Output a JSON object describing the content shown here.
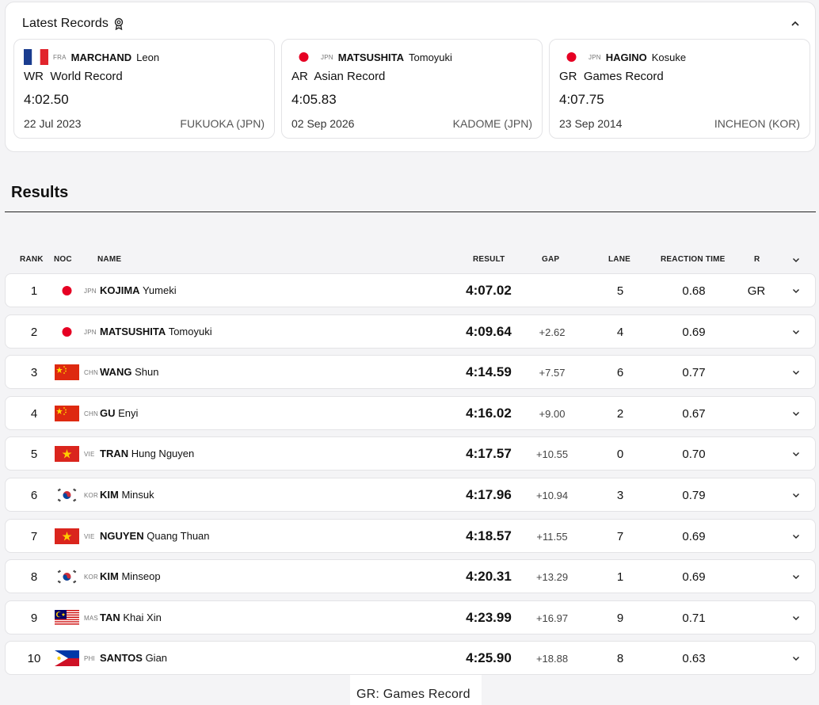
{
  "latest_records": {
    "title": "Latest Records",
    "cards": [
      {
        "noc": "FRA",
        "surname": "MARCHAND",
        "given": "Leon",
        "type_code": "WR",
        "type_name": "World Record",
        "time": "4:02.50",
        "date": "22 Jul 2023",
        "place": "FUKUOKA (JPN)"
      },
      {
        "noc": "JPN",
        "surname": "MATSUSHITA",
        "given": "Tomoyuki",
        "type_code": "AR",
        "type_name": "Asian Record",
        "time": "4:05.83",
        "date": "02 Sep 2026",
        "place": "KADOME (JPN)"
      },
      {
        "noc": "JPN",
        "surname": "HAGINO",
        "given": "Kosuke",
        "type_code": "GR",
        "type_name": "Games Record",
        "time": "4:07.75",
        "date": "23 Sep 2014",
        "place": "INCHEON (KOR)"
      }
    ]
  },
  "results": {
    "heading": "Results",
    "columns": {
      "rank": "RANK",
      "noc": "NOC",
      "name": "NAME",
      "result": "RESULT",
      "gap": "GAP",
      "lane": "LANE",
      "reaction": "REACTION TIME",
      "r": "R"
    },
    "rows": [
      {
        "rank": "1",
        "noc": "JPN",
        "surname": "KOJIMA",
        "given": "Yumeki",
        "result": "4:07.02",
        "gap": "",
        "lane": "5",
        "reaction": "0.68",
        "r": "GR"
      },
      {
        "rank": "2",
        "noc": "JPN",
        "surname": "MATSUSHITA",
        "given": "Tomoyuki",
        "result": "4:09.64",
        "gap": "+2.62",
        "lane": "4",
        "reaction": "0.69",
        "r": ""
      },
      {
        "rank": "3",
        "noc": "CHN",
        "surname": "WANG",
        "given": "Shun",
        "result": "4:14.59",
        "gap": "+7.57",
        "lane": "6",
        "reaction": "0.77",
        "r": ""
      },
      {
        "rank": "4",
        "noc": "CHN",
        "surname": "GU",
        "given": "Enyi",
        "result": "4:16.02",
        "gap": "+9.00",
        "lane": "2",
        "reaction": "0.67",
        "r": ""
      },
      {
        "rank": "5",
        "noc": "VIE",
        "surname": "TRAN",
        "given": "Hung Nguyen",
        "result": "4:17.57",
        "gap": "+10.55",
        "lane": "0",
        "reaction": "0.70",
        "r": ""
      },
      {
        "rank": "6",
        "noc": "KOR",
        "surname": "KIM",
        "given": "Minsuk",
        "result": "4:17.96",
        "gap": "+10.94",
        "lane": "3",
        "reaction": "0.79",
        "r": ""
      },
      {
        "rank": "7",
        "noc": "VIE",
        "surname": "NGUYEN",
        "given": "Quang Thuan",
        "result": "4:18.57",
        "gap": "+11.55",
        "lane": "7",
        "reaction": "0.69",
        "r": ""
      },
      {
        "rank": "8",
        "noc": "KOR",
        "surname": "KIM",
        "given": "Minseop",
        "result": "4:20.31",
        "gap": "+13.29",
        "lane": "1",
        "reaction": "0.69",
        "r": ""
      },
      {
        "rank": "9",
        "noc": "MAS",
        "surname": "TAN",
        "given": "Khai Xin",
        "result": "4:23.99",
        "gap": "+16.97",
        "lane": "9",
        "reaction": "0.71",
        "r": ""
      },
      {
        "rank": "10",
        "noc": "PHI",
        "surname": "SANTOS",
        "given": "Gian",
        "result": "4:25.90",
        "gap": "+18.88",
        "lane": "8",
        "reaction": "0.63",
        "r": ""
      }
    ]
  },
  "tooltip": {
    "text": "GR: Games Record"
  },
  "icons": {
    "records": "award-icon",
    "collapse": "chevron-up-icon",
    "expand": "chevron-down-icon"
  }
}
